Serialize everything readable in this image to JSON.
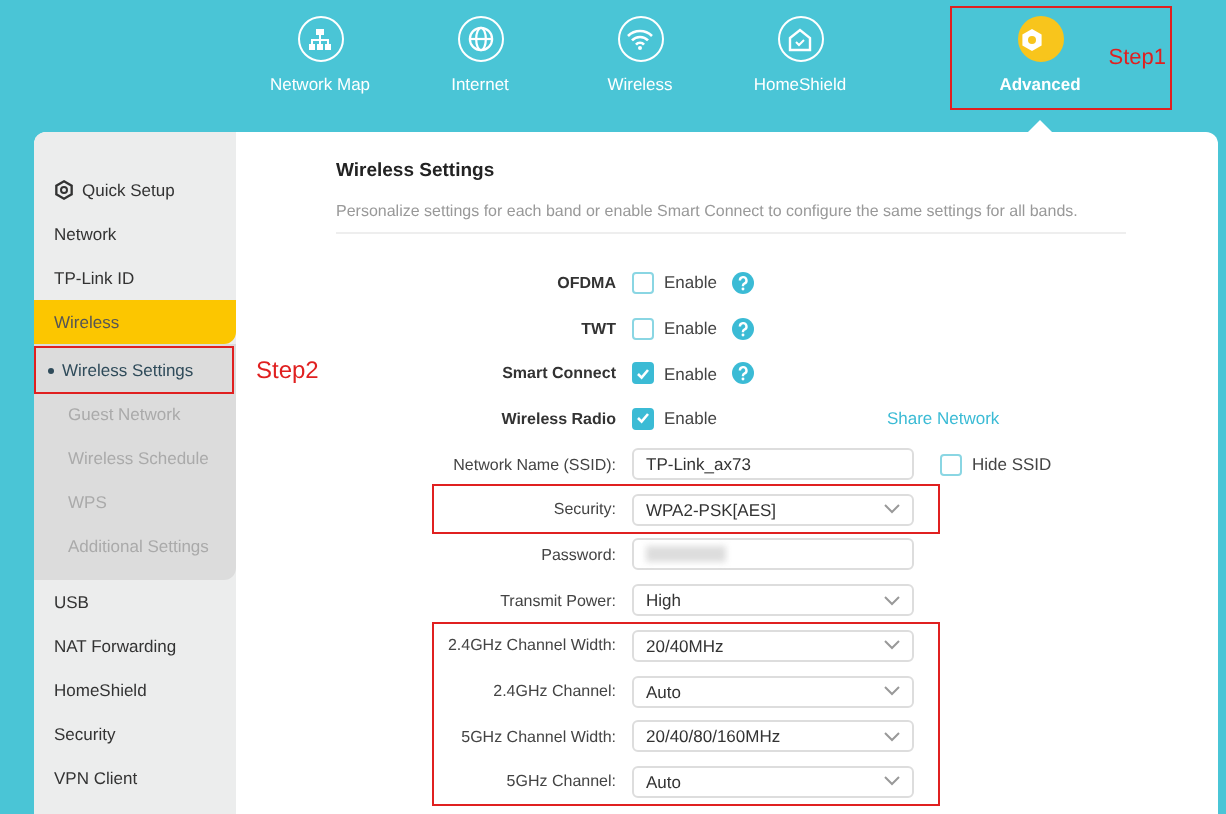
{
  "nav": [
    {
      "label": "Network Map",
      "selected": false,
      "highlighted": false
    },
    {
      "label": "Internet",
      "selected": false,
      "highlighted": false
    },
    {
      "label": "Wireless",
      "selected": false,
      "highlighted": false
    },
    {
      "label": "HomeShield",
      "selected": false,
      "highlighted": false
    },
    {
      "label": "Advanced",
      "selected": true,
      "highlighted": true,
      "step_label": "Step1"
    }
  ],
  "sidebar": {
    "items": [
      {
        "label": "Quick Setup",
        "selected": false
      },
      {
        "label": "Network",
        "selected": false
      },
      {
        "label": "TP-Link ID",
        "selected": false
      },
      {
        "label": "Wireless",
        "selected": true,
        "children": [
          {
            "label": "Wireless Settings",
            "selected": true,
            "highlighted": true,
            "step_label": "Step2"
          },
          {
            "label": "Guest Network",
            "selected": false,
            "highlighted": false
          },
          {
            "label": "Wireless Schedule",
            "selected": false,
            "highlighted": false
          },
          {
            "label": "WPS",
            "selected": false,
            "highlighted": false
          },
          {
            "label": "Additional Settings",
            "selected": false,
            "highlighted": false
          }
        ]
      },
      {
        "label": "USB",
        "selected": false
      },
      {
        "label": "NAT Forwarding",
        "selected": false
      },
      {
        "label": "HomeShield",
        "selected": false
      },
      {
        "label": "Security",
        "selected": false
      },
      {
        "label": "VPN Client",
        "selected": false
      }
    ]
  },
  "content": {
    "title": "Wireless Settings",
    "description": "Personalize settings for each band or enable Smart Connect to configure the same settings for all bands.",
    "groups": [
      {
        "highlighted": false,
        "rows": [
          {
            "kind": "checkbox",
            "label": "OFDMA",
            "option": "Enable",
            "checked": false,
            "help": true
          },
          {
            "kind": "checkbox",
            "label": "TWT",
            "option": "Enable",
            "checked": false,
            "help": true
          },
          {
            "kind": "checkbox",
            "label": "Smart Connect",
            "option": "Enable",
            "checked": true,
            "help": true
          },
          {
            "kind": "checkbox",
            "label": "Wireless Radio",
            "option": "Enable",
            "checked": true,
            "link": "Share Network"
          },
          {
            "kind": "text",
            "label": "Network Name (SSID):",
            "value": "TP-Link_ax73",
            "extra_option": "Hide SSID",
            "extra_checked": false
          }
        ]
      },
      {
        "highlighted": true,
        "rows": [
          {
            "kind": "select",
            "label": "Security:",
            "value": "WPA2-PSK[AES]"
          }
        ]
      },
      {
        "highlighted": false,
        "rows": [
          {
            "kind": "password",
            "label": "Password:"
          },
          {
            "kind": "select",
            "label": "Transmit Power:",
            "value": "High"
          }
        ]
      },
      {
        "highlighted": true,
        "rows": [
          {
            "kind": "select",
            "label": "2.4GHz Channel Width:",
            "value": "20/40MHz"
          },
          {
            "kind": "select",
            "label": "2.4GHz Channel:",
            "value": "Auto"
          },
          {
            "kind": "select",
            "label": "5GHz Channel Width:",
            "value": "20/40/80/160MHz"
          },
          {
            "kind": "select",
            "label": "5GHz Channel:",
            "value": "Auto"
          }
        ]
      }
    ]
  }
}
